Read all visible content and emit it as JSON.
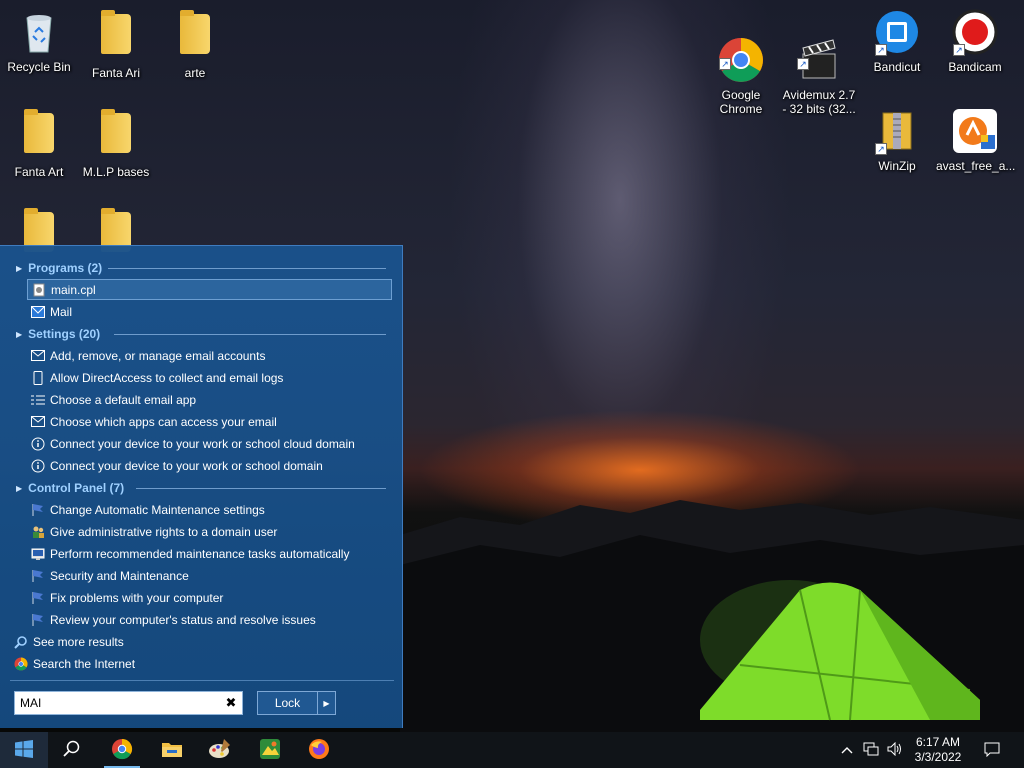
{
  "desktop": {
    "icons_left": [
      {
        "label": "Recycle Bin"
      },
      {
        "label": "Fanta Ari"
      },
      {
        "label": "arte"
      },
      {
        "label": "Fanta Art"
      },
      {
        "label": "M.L.P bases"
      }
    ],
    "icons_right": [
      {
        "label": "Google\nChrome"
      },
      {
        "label": "Avidemux 2.7\n- 32 bits (32..."
      },
      {
        "label": "Bandicut"
      },
      {
        "label": "Bandicam"
      },
      {
        "label": "WinZip"
      },
      {
        "label": "avast_free_a..."
      }
    ]
  },
  "start_menu": {
    "groups": {
      "programs": "Programs (2)",
      "settings": "Settings (20)",
      "control_panel": "Control Panel (7)"
    },
    "programs": [
      "main.cpl",
      "Mail"
    ],
    "settings": [
      "Add, remove, or manage email accounts",
      "Allow DirectAccess to collect and email logs",
      "Choose a default email app",
      "Choose which apps can access your email",
      "Connect your device to your work or school cloud domain",
      "Connect your device to your work or school domain"
    ],
    "control_panel": [
      "Change Automatic Maintenance settings",
      "Give administrative rights to a domain user",
      "Perform recommended maintenance tasks automatically",
      "Security and Maintenance",
      "Fix problems with your computer",
      "Review your computer's status and resolve issues"
    ],
    "see_more": "See more results",
    "search_internet": "Search the Internet",
    "search_value": "MAI",
    "lock_label": "Lock"
  },
  "taskbar": {
    "time": "6:17 AM",
    "date": "3/3/2022"
  }
}
